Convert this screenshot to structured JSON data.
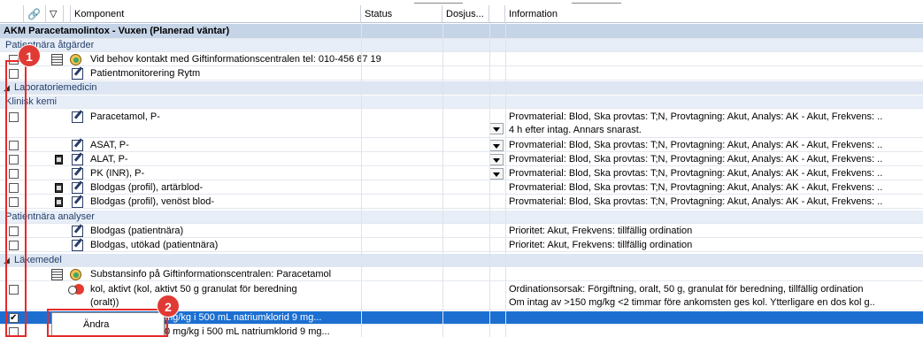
{
  "header": {
    "komponent": "Komponent",
    "status": "Status",
    "dosjus": "Dosjus...",
    "information": "Information"
  },
  "group_title": "AKM Paracetamolintox - Vuxen (Planerad väntar)",
  "sections": {
    "patientnara_atgarder": "Patientnära åtgärder",
    "laboratoriemedicin": "Laboratoriemedicin",
    "klinisk_kemi": "Klinisk kemi",
    "patientnara_analyser": "Patientnära analyser",
    "lakemedel": "Läkemedel"
  },
  "rows": {
    "giftinfo_contact": "Vid behov kontakt med Giftinformationscentralen tel: 010-456 67 19",
    "patientmonitorering": "Patientmonitorering Rytm",
    "paracetamol": "Paracetamol, P-",
    "paracetamol_info_1": "Provmaterial: Blod, Ska provtas: T;N, Provtagning: Akut, Analys: AK - Akut, Frekvens: ..",
    "paracetamol_info_2": "4 h efter intag. Annars snarast.",
    "asat": "ASAT, P-",
    "asat_info": "Provmaterial: Blod, Ska provtas: T;N, Provtagning: Akut, Analys: AK - Akut, Frekvens: ..",
    "alat": "ALAT, P-",
    "alat_info": "Provmaterial: Blod, Ska provtas: T;N, Provtagning: Akut, Analys: AK - Akut, Frekvens: ..",
    "pk_inr": "PK (INR), P-",
    "pk_inr_info": "Provmaterial: Blod, Ska provtas: T;N, Provtagning: Akut, Analys: AK - Akut, Frekvens: ..",
    "blodgas_art": "Blodgas (profil), artärblod-",
    "blodgas_art_info": "Provmaterial: Blod, Ska provtas: T;N, Provtagning: Akut, Analys: AK - Akut, Frekvens: ..",
    "blodgas_ven": "Blodgas (profil), venöst blod-",
    "blodgas_ven_info": "Provmaterial: Blod, Ska provtas: T;N, Provtagning: Akut, Analys: AK - Akut, Frekvens: ..",
    "blodgas_pn": "Blodgas (patientnära)",
    "blodgas_pn_info": "Prioritet: Akut, Frekvens: tillfällig ordination",
    "blodgas_utokad": "Blodgas, utökad (patientnära)",
    "blodgas_utokad_info": "Prioritet: Akut, Frekvens: tillfällig ordination",
    "substansinfo": "Substansinfo på Giftinformationscentralen: Paracetamol",
    "kol_1": "kol, aktivt (kol, aktivt 50 g granulat för beredning",
    "kol_2": "(oralt))",
    "kol_info_1": "Ordinationsorsak: Förgiftning, oralt, 50 g, granulat för beredning, tillfällig ordination",
    "kol_info_2": "Om intag av >150 mg/kg <2 timmar före ankomsten ges kol. Ytterligare en dos kol g..",
    "selected_row": "mg/kg i 500 mL natriumklorid 9 mg...",
    "last_row": "0 mg/kg i 500 mL natriumklorid 9 mg..."
  },
  "context_menu": {
    "andra": "Ändra"
  },
  "badges": {
    "one": "1",
    "two": "2"
  },
  "colors": {
    "selection": "#1c6fd1",
    "annotation_red": "#e52a2a",
    "group_header": "#c6d4e8"
  }
}
